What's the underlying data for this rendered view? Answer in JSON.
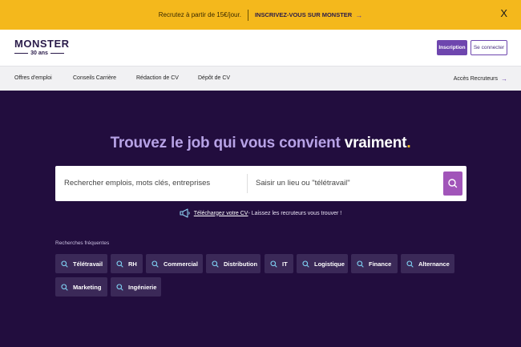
{
  "promo": {
    "text": "Recrutez à partir de 15€/jour.",
    "cta": "INSCRIVEZ-VOUS SUR MONSTER",
    "arrow": "→",
    "close": "X"
  },
  "logo": {
    "wordmark": "MONSTER",
    "anniversary": "30 ans"
  },
  "header": {
    "signup": "Inscription",
    "login": "Se connecter"
  },
  "nav": {
    "items": [
      "Offres d'emploi",
      "Conseils Carrière",
      "Rédaction de CV",
      "Dépôt de CV"
    ],
    "recruiters": "Accès Recruteurs",
    "arrow": "→"
  },
  "hero": {
    "title_main": "Trouvez le job qui vous convient ",
    "title_strong": "vraiment",
    "title_dot": "."
  },
  "search": {
    "keyword_placeholder": "Rechercher emplois, mots clés, entreprises",
    "location_placeholder": "Saisir un lieu ou \"télétravail\""
  },
  "upload": {
    "link": "Téléchargez votre CV",
    "rest": " - Laissez les recruteurs vous trouver !"
  },
  "frequent": {
    "label": "Recherches fréquentes",
    "chips": [
      "Télétravail",
      "RH",
      "Commercial",
      "Distribution",
      "IT",
      "Logistique",
      "Finance",
      "Alternance",
      "Marketing",
      "Ingénierie"
    ]
  },
  "colors": {
    "brand": "#6e46ae",
    "hero_bg": "#220d3e",
    "promo_bg": "#f4b81c",
    "chip_bg": "#3b2958",
    "search_button": "#a155b9"
  },
  "icons": {
    "search": "search-icon",
    "megaphone": "megaphone-icon",
    "close": "close-icon",
    "arrow": "arrow-right-icon"
  }
}
